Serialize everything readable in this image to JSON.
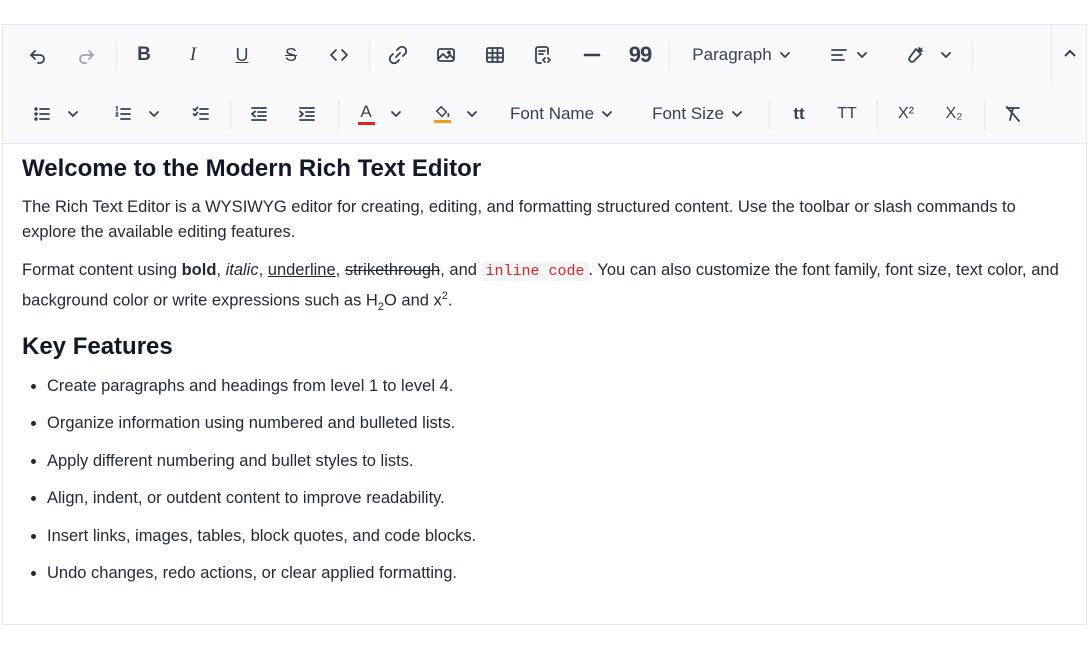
{
  "toolbar": {
    "row1": {
      "paragraph_format": "Paragraph"
    },
    "row2": {
      "font_name": "Font Name",
      "font_size": "Font Size",
      "lowercase": "tt",
      "uppercase": "TT",
      "superscript": "X²",
      "subscript": "X₂"
    },
    "icons": [
      "undo-icon",
      "redo-icon",
      "bold-icon",
      "italic-icon",
      "underline-icon",
      "strikethrough-icon",
      "inline-code-icon",
      "link-icon",
      "image-icon",
      "table-icon",
      "code-block-icon",
      "horizontal-line-icon",
      "blockquote-icon",
      "align-icon",
      "format-painter-icon",
      "bulleted-list-icon",
      "numbered-list-icon",
      "checklist-icon",
      "outdent-icon",
      "indent-icon",
      "font-color-icon",
      "background-color-icon",
      "clear-format-icon",
      "collapse-icon"
    ],
    "colors": {
      "font_color_bar": "#dc2626",
      "background_color_bar": "#f59e0b"
    }
  },
  "content": {
    "heading1": "Welcome to the Modern Rich Text Editor",
    "intro": "The Rich Text Editor is a WYSIWYG editor for creating, editing, and formatting structured content. Use the toolbar or slash commands to explore the available editing features.",
    "format_line": {
      "prefix": "Format content using ",
      "bold": "bold",
      "sep1": ", ",
      "italic": "italic",
      "sep2": ", ",
      "underline": "underline",
      "sep3": ", ",
      "strike": "strikethrough",
      "sep4": ", and ",
      "code": "inline code",
      "middle": ". You can also customize the font family, font size, text color, and background color or write expressions such as H",
      "sub": "2",
      "after_sub": "O and x",
      "sup": "2",
      "end": "."
    },
    "heading2": "Key Features",
    "features": [
      "Create paragraphs and headings from level 1 to level 4.",
      "Organize information using numbered and bulleted lists.",
      "Apply different numbering and bullet styles to lists.",
      "Align, indent, or outdent content to improve readability.",
      "Insert links, images, tables, block quotes, and code blocks.",
      "Undo changes, redo actions, or clear applied formatting."
    ]
  }
}
